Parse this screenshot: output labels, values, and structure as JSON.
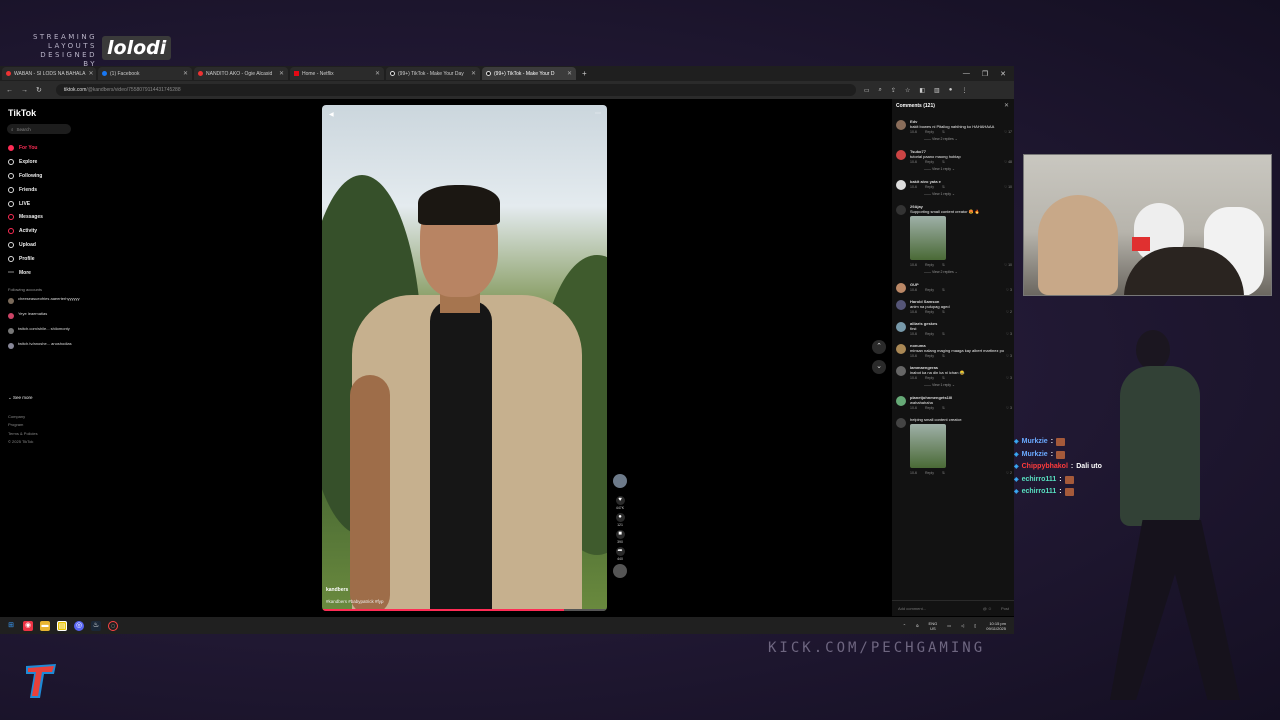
{
  "overlay": {
    "layouts_small": "STREAMING LAYOUTS DESIGNED BY",
    "layouts_big": "lolodi",
    "kick_url": "KICK.COM/PECHGAMING"
  },
  "browser": {
    "tabs": [
      {
        "label": "WABAN - SI LODS NA BAHALA"
      },
      {
        "label": "(1) Facebook"
      },
      {
        "label": "NANDITO AKO - Ogie Alcasid"
      },
      {
        "label": "Home - Netflix"
      },
      {
        "label": "(99+) TikTok - Make Your Day"
      },
      {
        "label": "(99+) TikTok - Make Your D",
        "active": true
      }
    ],
    "new_tab": "+",
    "url_host": "tiktok.com",
    "url_path": "/@kandbers/video/7558079114431745288"
  },
  "tiktok": {
    "logo": "TikTok",
    "search_placeholder": "Search",
    "nav": [
      {
        "label": "For You",
        "active": true
      },
      {
        "label": "Explore"
      },
      {
        "label": "Following"
      },
      {
        "label": "Friends"
      },
      {
        "label": "LIVE"
      },
      {
        "label": "Messages"
      },
      {
        "label": "Activity"
      },
      {
        "label": "Upload"
      },
      {
        "label": "Profile"
      },
      {
        "label": "More"
      }
    ],
    "following_title": "Following accounts",
    "following": [
      {
        "name": "cheeseasueofries aaeerterhyyyyyy"
      },
      {
        "name": "Yeye leaematias"
      },
      {
        "name": "twitch.com/shile... shilomonty"
      },
      {
        "name": "twitch.tv/anoshe... anoshodias"
      }
    ],
    "see_more": "See more",
    "footer": [
      "Company",
      "Program",
      "Terms & Policies",
      "© 2025 TikTok"
    ]
  },
  "video": {
    "username": "kandbers",
    "caption": "#kandbers #babypatrick #fyp",
    "progress": 0.85,
    "actions": [
      {
        "icon": "heart-icon",
        "glyph": "♥",
        "count": "447K"
      },
      {
        "icon": "comment-icon",
        "glyph": "●",
        "count": "121"
      },
      {
        "icon": "bookmark-icon",
        "glyph": "■",
        "count": "390"
      },
      {
        "icon": "share-icon",
        "glyph": "➦",
        "count": "440"
      }
    ]
  },
  "comments": {
    "header": "Comments (121)",
    "items": [
      {
        "user": "Edv",
        "text": "bakit bowes ni Pitallog nahihing ko HAHAHAAA",
        "date": "10-6",
        "reply": "Reply",
        "likes": "17",
        "view": "View 2 replies"
      },
      {
        "user": "Tsuko77",
        "text": "tutorial paano maong hoblap",
        "date": "10-6",
        "reply": "Reply",
        "likes": "48",
        "view": "View 1 reply"
      },
      {
        "user": "bakit aivo yata e",
        "text": "",
        "date": "10-6",
        "reply": "Reply",
        "likes": "10",
        "view": "View 1 reply"
      },
      {
        "user": "29Ajay",
        "text": "Supporting small content creator 😍 🔥",
        "date": "10-6",
        "reply": "Reply",
        "likes": "10",
        "view": "View 2 replies",
        "thumb": true
      },
      {
        "user": "GUP",
        "text": "",
        "date": "10-6",
        "reply": "Reply",
        "likes": "3"
      },
      {
        "user": "Harold Samson",
        "text": "anim na pulupag aged",
        "date": "10-6",
        "reply": "Reply",
        "likes": "2"
      },
      {
        "user": "alliaris geskes",
        "text": "first",
        "date": "10-6",
        "reply": "Reply",
        "likes": "3"
      },
      {
        "user": "nonuma",
        "text": "minsan nalang maging maaga kay albert martinez po",
        "date": "10-6",
        "reply": "Reply",
        "likes": "3"
      },
      {
        "user": "lammaengeras",
        "text": "inabot ka na din ka ni ichan 😂",
        "date": "10-6",
        "reply": "Reply",
        "likes": "3",
        "view": "View 1 reply"
      },
      {
        "user": "planetjohnmengets1lll",
        "text": "wahahahaha",
        "date": "10-6",
        "reply": "Reply",
        "likes": "3"
      },
      {
        "user": "",
        "text": "helping small content creator:",
        "date": "10-6",
        "reply": "Reply",
        "likes": "2",
        "thumb": true
      }
    ],
    "add_placeholder": "Add comment...",
    "post": "Post"
  },
  "taskbar": {
    "lang_top": "ENG",
    "lang_bottom": "US",
    "time": "10:15 pm",
    "date": "09/11/2025"
  },
  "chat": [
    {
      "user": "Murkzie",
      "color": "#6aa9ff",
      "msg": ""
    },
    {
      "user": "Murkzie",
      "color": "#6aa9ff",
      "msg": ""
    },
    {
      "user": "Chippybhakol",
      "color": "#ff3b3b",
      "msg": "Dali uto"
    },
    {
      "user": "echirro111",
      "color": "#58e0c0",
      "msg": ""
    },
    {
      "user": "echirro111",
      "color": "#58e0c0",
      "msg": ""
    }
  ]
}
